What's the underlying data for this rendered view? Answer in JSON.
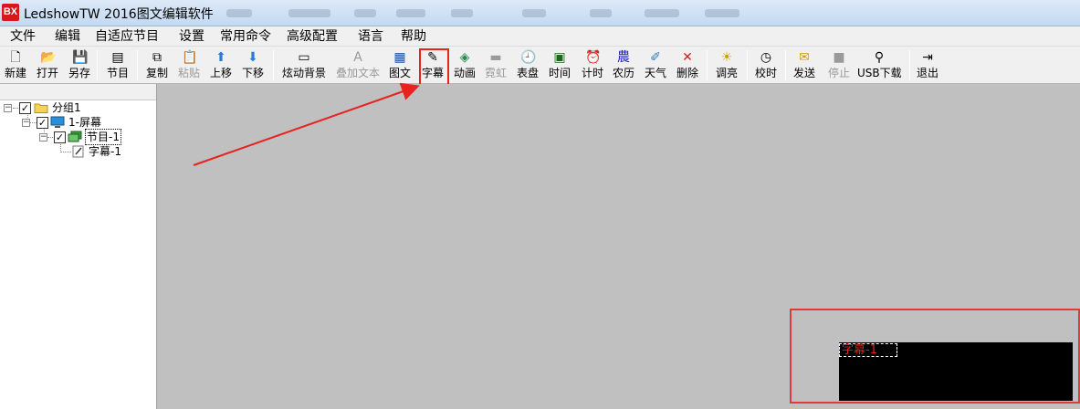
{
  "window": {
    "title": "LedshowTW 2016图文编辑软件",
    "logo_text": "BX"
  },
  "menu": [
    "文件",
    "编辑",
    "自适应节目",
    "设置",
    "常用命令",
    "高级配置",
    "语言",
    "帮助"
  ],
  "toolbar": [
    {
      "label": "新建",
      "icon": "new-file-icon",
      "glyph": "🗋",
      "enabled": true
    },
    {
      "label": "打开",
      "icon": "open-folder-icon",
      "glyph": "📂",
      "enabled": true
    },
    {
      "label": "另存",
      "icon": "floppy-disk-icon",
      "glyph": "💾",
      "enabled": true
    },
    {
      "label": "节目",
      "icon": "program-icon",
      "glyph": "▤",
      "enabled": true
    },
    {
      "label": "复制",
      "icon": "copy-icon",
      "glyph": "⧉",
      "enabled": true
    },
    {
      "label": "粘贴",
      "icon": "paste-icon",
      "glyph": "📋",
      "enabled": false
    },
    {
      "label": "上移",
      "icon": "arrow-up-icon",
      "glyph": "⬆",
      "enabled": true
    },
    {
      "label": "下移",
      "icon": "arrow-down-icon",
      "glyph": "⬇",
      "enabled": true
    },
    {
      "label": "炫动背景",
      "icon": "dynamic-background-icon",
      "glyph": "▭",
      "enabled": true
    },
    {
      "label": "叠加文本",
      "icon": "overlay-text-icon",
      "glyph": "A",
      "enabled": false
    },
    {
      "label": "图文",
      "icon": "image-text-icon",
      "glyph": "▦",
      "enabled": true
    },
    {
      "label": "字幕",
      "icon": "subtitle-icon",
      "glyph": "✎",
      "enabled": true
    },
    {
      "label": "动画",
      "icon": "animation-icon",
      "glyph": "◈",
      "enabled": true
    },
    {
      "label": "霓虹",
      "icon": "neon-icon",
      "glyph": "▬",
      "enabled": false
    },
    {
      "label": "表盘",
      "icon": "clock-dial-icon",
      "glyph": "🕘",
      "enabled": true
    },
    {
      "label": "时间",
      "icon": "time-icon",
      "glyph": "▣",
      "enabled": true
    },
    {
      "label": "计时",
      "icon": "alarm-clock-icon",
      "glyph": "⏰",
      "enabled": true
    },
    {
      "label": "农历",
      "icon": "lunar-calendar-icon",
      "glyph": "農",
      "enabled": true
    },
    {
      "label": "天气",
      "icon": "weather-icon",
      "glyph": "✐",
      "enabled": true
    },
    {
      "label": "删除",
      "icon": "delete-x-icon",
      "glyph": "✕",
      "enabled": true
    },
    {
      "label": "调亮",
      "icon": "brightness-bulb-icon",
      "glyph": "☀",
      "enabled": true
    },
    {
      "label": "校时",
      "icon": "time-sync-icon",
      "glyph": "◷",
      "enabled": true
    },
    {
      "label": "发送",
      "icon": "send-envelope-icon",
      "glyph": "✉",
      "enabled": true
    },
    {
      "label": "停止",
      "icon": "stop-icon",
      "glyph": "■",
      "enabled": false
    },
    {
      "label": "USB下载",
      "icon": "usb-icon",
      "glyph": "⚲",
      "enabled": true
    },
    {
      "label": "退出",
      "icon": "exit-door-icon",
      "glyph": "⇥",
      "enabled": true
    }
  ],
  "tree": {
    "group": "分组1",
    "screen": "1-屏幕",
    "program": "节目-1",
    "subtitle": "字幕-1"
  },
  "preview": {
    "item_label": "字幕-1"
  },
  "colors": {
    "highlight_red": "#e8221f",
    "subtitle_text": "#e0201a",
    "workspace": "#c0c0c0"
  }
}
